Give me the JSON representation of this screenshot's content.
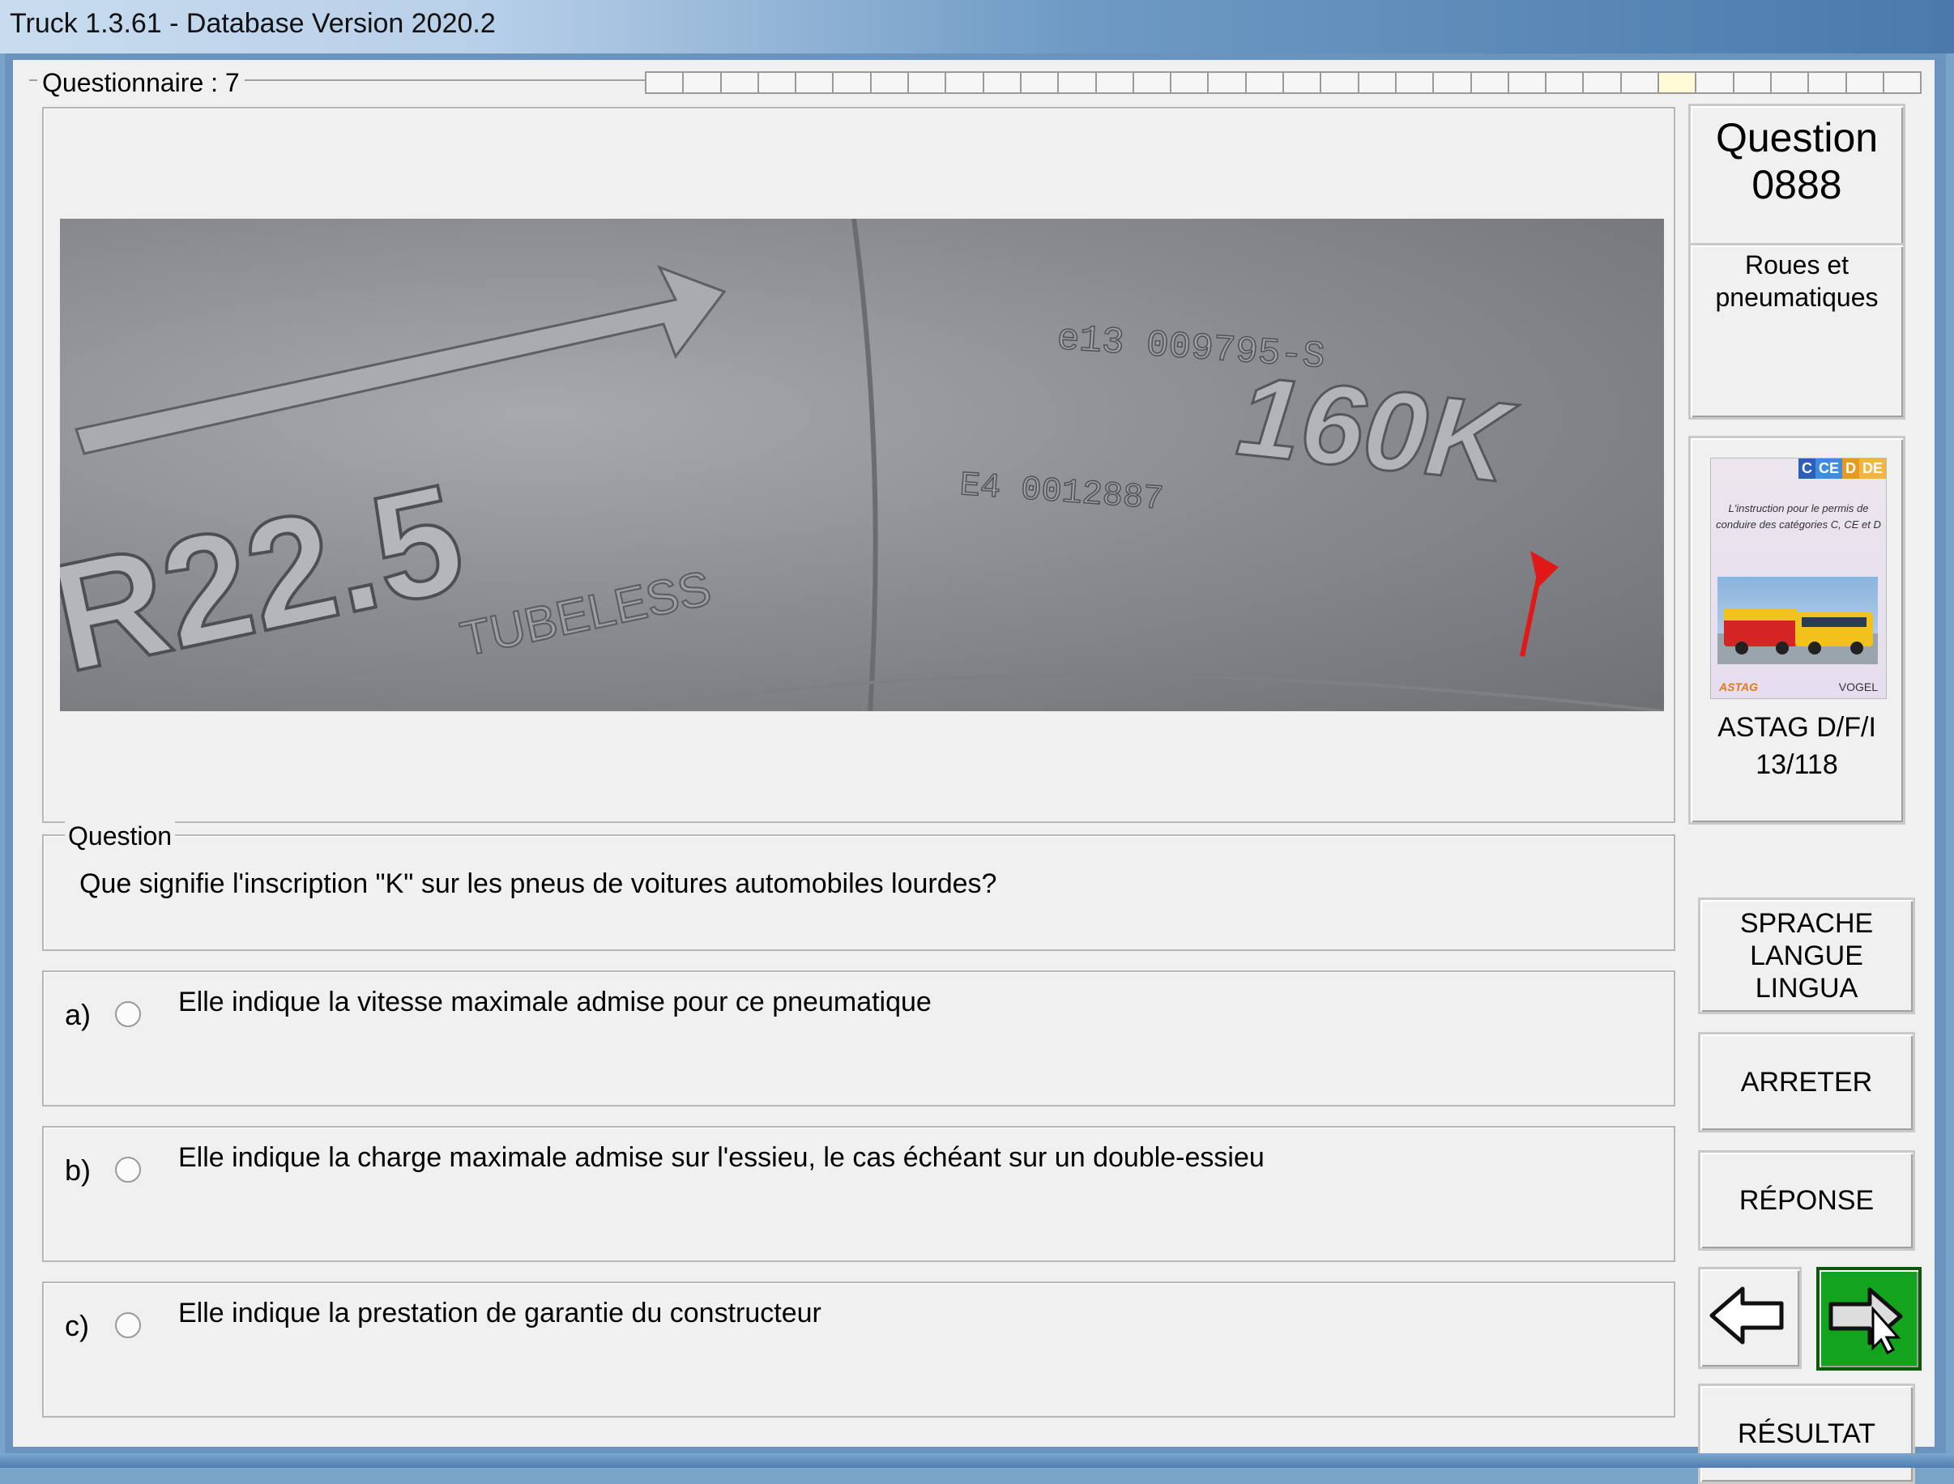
{
  "window": {
    "title": "Truck 1.3.61 - Database Version 2020.2"
  },
  "questionnaire": {
    "label": "Questionnaire : 7",
    "progress_total": 34,
    "progress_current": 28
  },
  "photo": {
    "tire_size": "R22.5",
    "tubeless": "TUBELESS",
    "marking_top": "e13  009795-S",
    "marking_mid": "E4  0012887",
    "load_speed": "160K"
  },
  "question": {
    "legend": "Question",
    "text": "Que signifie l'inscription \"K\" sur les pneus de voitures automobiles lourdes?"
  },
  "answers": [
    {
      "letter": "a)",
      "text": "Elle indique la vitesse maximale admise pour ce pneumatique"
    },
    {
      "letter": "b)",
      "text": "Elle indique la charge maximale admise sur l'essieu, le cas échéant sur un double-essieu"
    },
    {
      "letter": "c)",
      "text": "Elle indique la prestation de garantie du constructeur"
    }
  ],
  "sidebar": {
    "question_label": "Question",
    "question_number": "0888",
    "category": "Roues et pneumatiques",
    "book": {
      "badges": [
        "C",
        "CE",
        "D",
        "DE"
      ],
      "cover_text": "L'instruction pour le permis de conduire des catégories C, CE et D",
      "logo_left": "ASTAG",
      "logo_right": "VOGEL",
      "caption_line1": "ASTAG D/F/I",
      "caption_line2": "13/118"
    },
    "buttons": {
      "language_line1": "SPRACHE",
      "language_line2": "LANGUE",
      "language_line3": "LINGUA",
      "stop": "ARRETER",
      "answer": "RÉPONSE",
      "result": "RÉSULTAT"
    }
  },
  "colors": {
    "next_button": "#13a31c",
    "arrow_marker": "#e01818"
  }
}
